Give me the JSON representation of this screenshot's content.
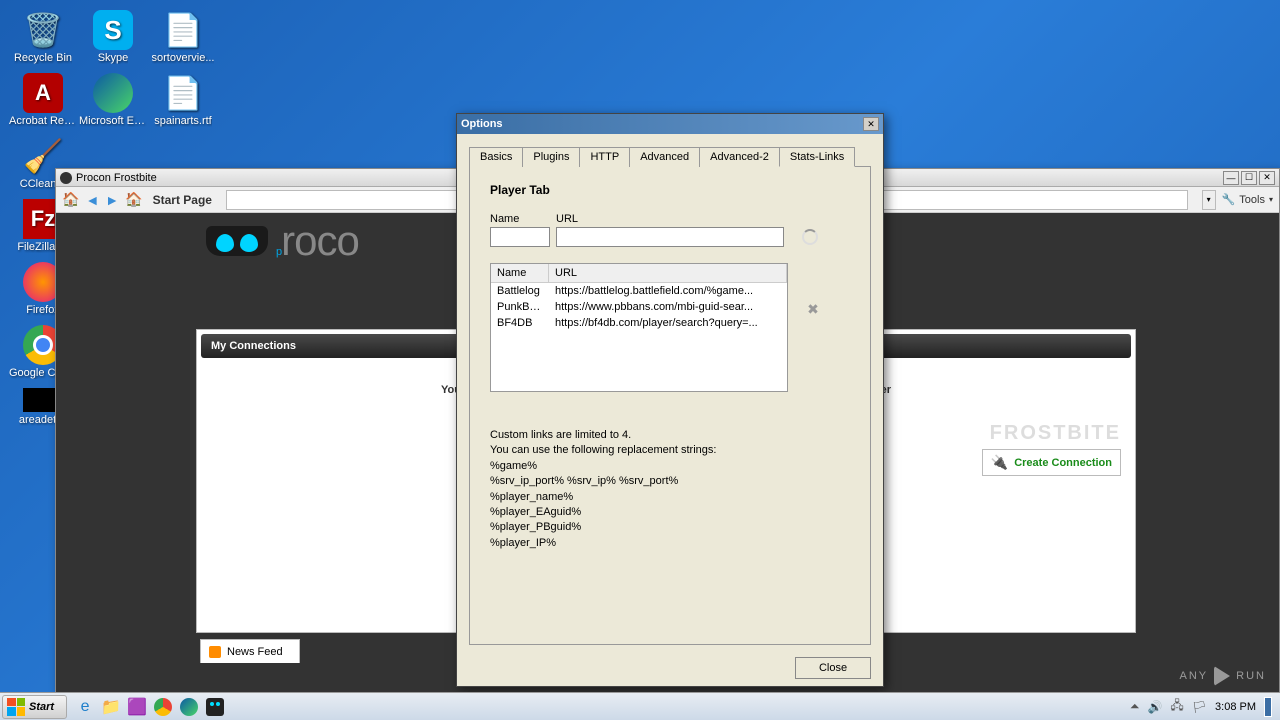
{
  "desktop": {
    "icons": [
      {
        "label": "Recycle Bin"
      },
      {
        "label": "Skype"
      },
      {
        "label": "sortovervie..."
      },
      {
        "label": "Acrobat Reader D"
      },
      {
        "label": "Microsoft Edge"
      },
      {
        "label": "spainarts.rtf"
      },
      {
        "label": "CCleaner"
      },
      {
        "label": ""
      },
      {
        "label": ""
      },
      {
        "label": "FileZilla Cl"
      },
      {
        "label": ""
      },
      {
        "label": ""
      },
      {
        "label": "Firefox"
      },
      {
        "label": ""
      },
      {
        "label": ""
      },
      {
        "label": "Google Chrome"
      },
      {
        "label": ""
      },
      {
        "label": ""
      },
      {
        "label": "areadetail"
      }
    ]
  },
  "procon": {
    "title": "Procon Frostbite",
    "start_page": "Start Page",
    "tools_label": "Tools",
    "logo": "procon",
    "connections_hdr": "My Connections",
    "no_conn_msg": "You do not have any connections. Would you like to connect to a game server or layer",
    "frostbite": "FROSTBITE",
    "create_conn": "Create Connection",
    "news_feed": "News Feed"
  },
  "options": {
    "title": "Options",
    "tabs": [
      "Basics",
      "Plugins",
      "HTTP",
      "Advanced",
      "Advanced-2",
      "Stats-Links"
    ],
    "active_tab": 5,
    "player_tab": "Player Tab",
    "name_label": "Name",
    "url_label": "URL",
    "grid_hdr_name": "Name",
    "grid_hdr_url": "URL",
    "links": [
      {
        "name": "Battlelog",
        "url": "https://battlelog.battlefield.com/%game..."
      },
      {
        "name": "PunkBu...",
        "url": "https://www.pbbans.com/mbi-guid-sear..."
      },
      {
        "name": "BF4DB",
        "url": "https://bf4db.com/player/search?query=..."
      }
    ],
    "help1": "Custom links are limited to 4.",
    "help2": "You can use the following replacement strings:",
    "help3": "%game%",
    "help4": "%srv_ip_port%  %srv_ip%  %srv_port%",
    "help5": "%player_name%",
    "help6": "%player_EAguid%",
    "help7": "%player_PBguid%",
    "help8": "%player_IP%",
    "close_btn": "Close"
  },
  "taskbar": {
    "start": "Start",
    "time": "3:08 PM"
  },
  "watermark": "ANY      RUN"
}
